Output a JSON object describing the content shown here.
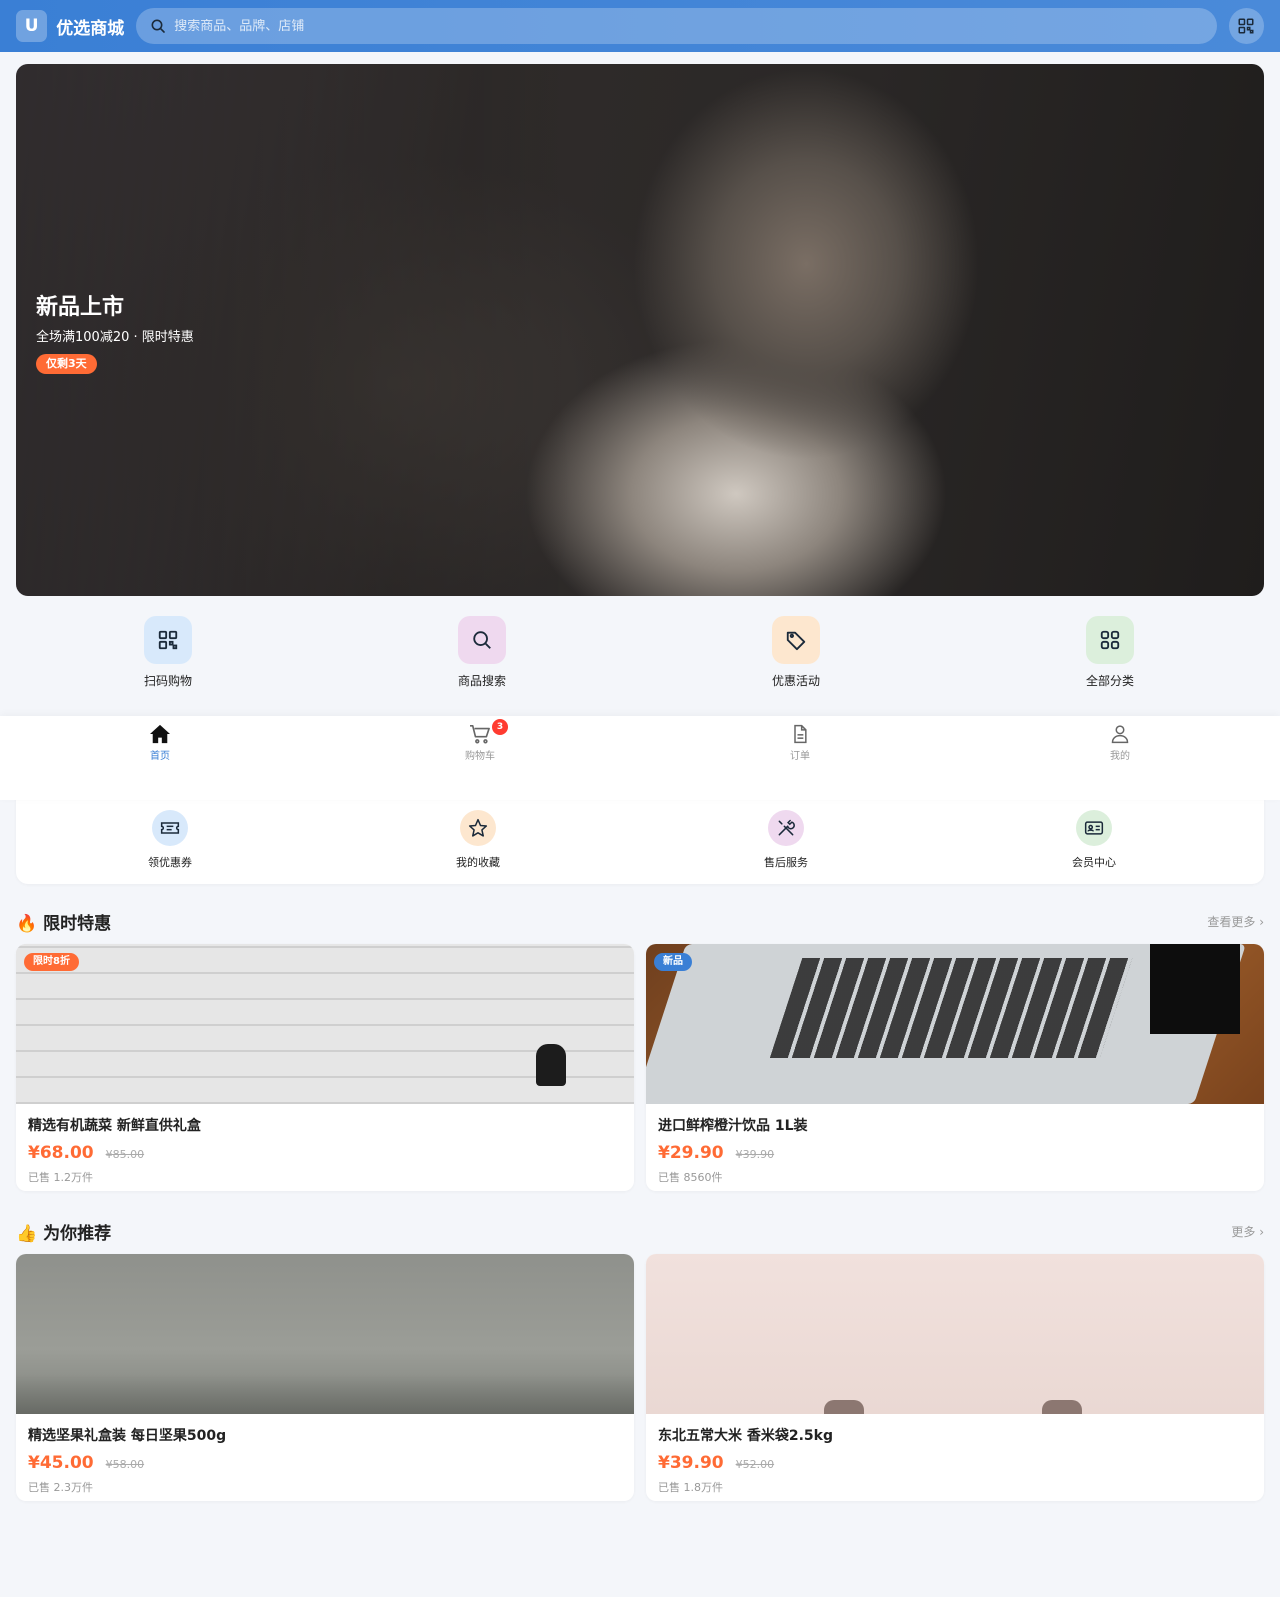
{
  "header": {
    "logo_text": "U",
    "app_title": "优选商城",
    "search_placeholder": "搜索商品、品牌、店铺",
    "scan_icon": "qrcode-scan-icon"
  },
  "banner": {
    "title": "新品上市",
    "subtitle": "全场满100减20 · 限时特惠",
    "tag": "仅剩3天"
  },
  "quick_entries": [
    {
      "label": "扫码购物",
      "icon": "qrcode-icon",
      "bg": "#d8e9fb"
    },
    {
      "label": "商品搜索",
      "icon": "search-icon",
      "bg": "#efd9ef"
    },
    {
      "label": "优惠活动",
      "icon": "tag-icon",
      "bg": "#fde7cf"
    },
    {
      "label": "全部分类",
      "icon": "grid-icon",
      "bg": "#dcefdc"
    }
  ],
  "tabbar": {
    "items": [
      {
        "label": "首页",
        "icon": "home-icon",
        "active": true
      },
      {
        "label": "购物车",
        "icon": "cart-icon",
        "active": false,
        "badge": "3"
      },
      {
        "label": "订单",
        "icon": "document-icon",
        "active": false
      },
      {
        "label": "我的",
        "icon": "user-icon",
        "active": false
      }
    ]
  },
  "services": [
    {
      "label": "领优惠券",
      "icon": "ticket-icon",
      "bg": "#d8e9fb"
    },
    {
      "label": "我的收藏",
      "icon": "star-icon",
      "bg": "#fde7cf"
    },
    {
      "label": "售后服务",
      "icon": "tools-icon",
      "bg": "#efd9ef"
    },
    {
      "label": "会员中心",
      "icon": "member-card-icon",
      "bg": "#dcefdc"
    }
  ],
  "sections": {
    "flash": {
      "title": "🔥 限时特惠",
      "more": "查看更多 ›",
      "products": [
        {
          "tag": "限时8折",
          "tag_color": "#ff6b35",
          "name": "精选有机蔬菜 新鲜直供礼盒",
          "price": "¥68.00",
          "original": "¥85.00",
          "sales": "已售 1.2万件"
        },
        {
          "tag": "新品",
          "tag_color": "#3a7fd5",
          "name": "进口鲜榨橙汁饮品 1L装",
          "price": "¥29.90",
          "original": "¥39.90",
          "sales": "已售 8560件"
        }
      ]
    },
    "recommend": {
      "title": "👍 为你推荐",
      "more": "更多 ›",
      "products": [
        {
          "name": "精选坚果礼盒装 每日坚果500g",
          "price": "¥45.00",
          "original": "¥58.00",
          "sales": "已售 2.3万件"
        },
        {
          "name": "东北五常大米 香米袋2.5kg",
          "price": "¥39.90",
          "original": "¥52.00",
          "sales": "已售 1.8万件"
        }
      ]
    }
  }
}
